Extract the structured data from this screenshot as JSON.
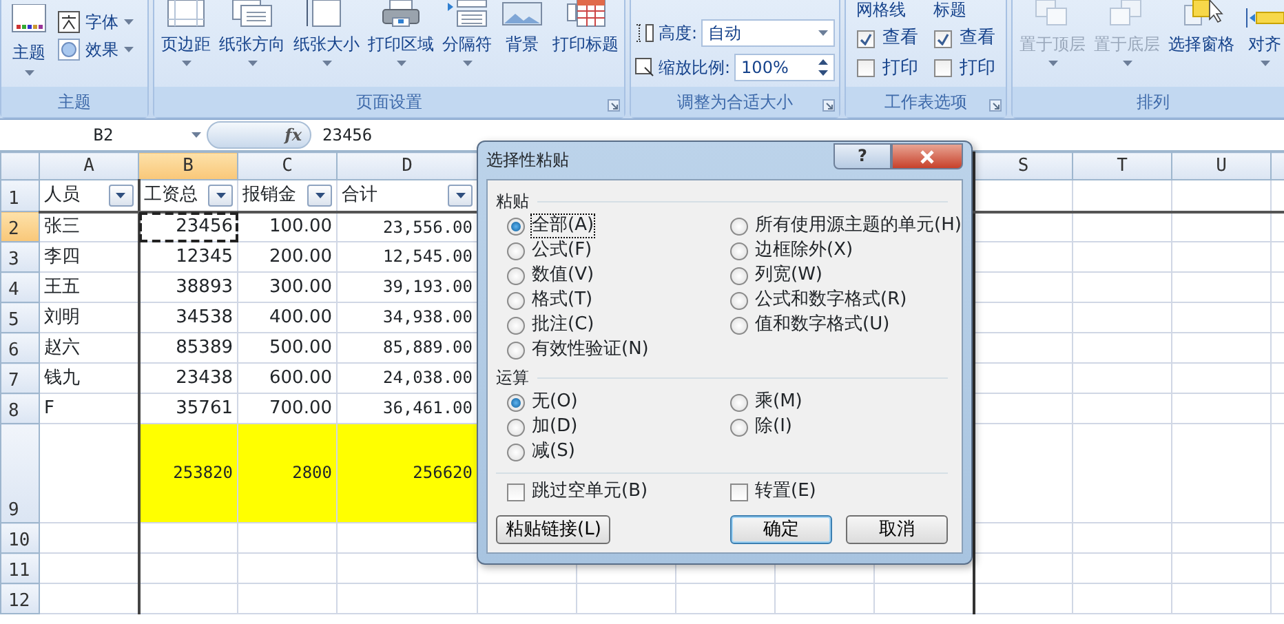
{
  "ribbon": {
    "groups": [
      {
        "kind": "theme",
        "title": "主题",
        "main": {
          "label": "主题",
          "dropdown": true
        },
        "items": [
          {
            "label": "字体",
            "dropdown": true
          },
          {
            "label": "效果",
            "dropdown": true
          }
        ],
        "launcher": false
      },
      {
        "kind": "buttons",
        "title": "页面设置",
        "buttons": [
          {
            "label": "页边距",
            "dropdown": true,
            "disabled": false
          },
          {
            "label": "纸张方向",
            "dropdown": true,
            "disabled": false
          },
          {
            "label": "纸张大小",
            "dropdown": true,
            "disabled": false
          },
          {
            "label": "打印区域",
            "dropdown": true,
            "disabled": false
          },
          {
            "label": "分隔符",
            "dropdown": true,
            "disabled": false
          },
          {
            "label": "背景",
            "dropdown": false,
            "disabled": false
          },
          {
            "label": "打印标题",
            "dropdown": false,
            "disabled": false
          }
        ],
        "launcher": true
      },
      {
        "kind": "fields",
        "title": "调整为合适大小",
        "fields": [
          {
            "kind": "dropdown",
            "label": "高度:",
            "value": "自动"
          },
          {
            "kind": "spin",
            "label": "缩放比例:",
            "value": "100%"
          }
        ],
        "launcher": true
      },
      {
        "kind": "options",
        "title": "工作表选项",
        "columns": [
          {
            "title": "网格线",
            "options": [
              {
                "label": "查看",
                "checked": true
              },
              {
                "label": "打印",
                "checked": false
              }
            ]
          },
          {
            "title": "标题",
            "options": [
              {
                "label": "查看",
                "checked": true
              },
              {
                "label": "打印",
                "checked": false
              }
            ]
          }
        ],
        "launcher": true
      },
      {
        "kind": "buttons",
        "title": "排列",
        "buttons": [
          {
            "label": "置于顶层",
            "dropdown": true,
            "disabled": true
          },
          {
            "label": "置于底层",
            "dropdown": true,
            "disabled": true
          },
          {
            "label": "选择窗格",
            "dropdown": false,
            "disabled": false
          },
          {
            "label": "对齐",
            "dropdown": true,
            "disabled": false
          }
        ],
        "launcher": false
      }
    ]
  },
  "formula_bar": {
    "name_box": "B2",
    "function_label": "fx",
    "value": "23456"
  },
  "sheet": {
    "columns_left": [
      {
        "label": "A",
        "selected": false
      },
      {
        "label": "B",
        "selected": true
      },
      {
        "label": "C",
        "selected": false
      },
      {
        "label": "D",
        "selected": false
      }
    ],
    "columns_right": [
      {
        "label": "S",
        "selected": false
      },
      {
        "label": "T",
        "selected": false
      },
      {
        "label": "U",
        "selected": false
      }
    ],
    "rows": [
      {
        "number": "1",
        "selected": false,
        "kind": "header",
        "cells": [
          {
            "text": "人员",
            "copied": false
          },
          {
            "text": "工资总",
            "copied": false
          },
          {
            "text": "报销金",
            "copied": false
          },
          {
            "text": "合计",
            "copied": false
          }
        ]
      },
      {
        "number": "2",
        "selected": true,
        "kind": "data",
        "cells": [
          {
            "text": "张三",
            "copied": false
          },
          {
            "text": "23456",
            "copied": true
          },
          {
            "text": "100.00",
            "copied": false
          },
          {
            "text": "23,556.00",
            "copied": false
          }
        ]
      },
      {
        "number": "3",
        "selected": false,
        "kind": "data",
        "cells": [
          {
            "text": "李四",
            "copied": false
          },
          {
            "text": "12345",
            "copied": false
          },
          {
            "text": "200.00",
            "copied": false
          },
          {
            "text": "12,545.00",
            "copied": false
          }
        ]
      },
      {
        "number": "4",
        "selected": false,
        "kind": "data",
        "cells": [
          {
            "text": "王五",
            "copied": false
          },
          {
            "text": "38893",
            "copied": false
          },
          {
            "text": "300.00",
            "copied": false
          },
          {
            "text": "39,193.00",
            "copied": false
          }
        ]
      },
      {
        "number": "5",
        "selected": false,
        "kind": "data",
        "cells": [
          {
            "text": "刘明",
            "copied": false
          },
          {
            "text": "34538",
            "copied": false
          },
          {
            "text": "400.00",
            "copied": false
          },
          {
            "text": "34,938.00",
            "copied": false
          }
        ]
      },
      {
        "number": "6",
        "selected": false,
        "kind": "data",
        "cells": [
          {
            "text": "赵六",
            "copied": false
          },
          {
            "text": "85389",
            "copied": false
          },
          {
            "text": "500.00",
            "copied": false
          },
          {
            "text": "85,889.00",
            "copied": false
          }
        ]
      },
      {
        "number": "7",
        "selected": false,
        "kind": "data",
        "cells": [
          {
            "text": "钱九",
            "copied": false
          },
          {
            "text": "23438",
            "copied": false
          },
          {
            "text": "600.00",
            "copied": false
          },
          {
            "text": "24,038.00",
            "copied": false
          }
        ]
      },
      {
        "number": "8",
        "selected": false,
        "kind": "data",
        "cells": [
          {
            "text": "F",
            "copied": false
          },
          {
            "text": "35761",
            "copied": false
          },
          {
            "text": "700.00",
            "copied": false
          },
          {
            "text": "36,461.00",
            "copied": false
          }
        ]
      },
      {
        "number": "9",
        "selected": false,
        "kind": "total",
        "cells": [
          null,
          {
            "text": "253820",
            "copied": false
          },
          {
            "text": "2800",
            "copied": false
          },
          {
            "text": "256620",
            "copied": false
          }
        ]
      },
      {
        "number": "10",
        "selected": false,
        "kind": "empty"
      },
      {
        "number": "11",
        "selected": false,
        "kind": "empty"
      },
      {
        "number": "12",
        "selected": false,
        "kind": "empty"
      }
    ]
  },
  "dialog": {
    "title": "选择性粘贴",
    "help": "?",
    "paste": {
      "title": "粘贴",
      "left": [
        {
          "label": "全部(A)",
          "selected": true,
          "focused": true
        },
        {
          "label": "公式(F)",
          "selected": false,
          "focused": false
        },
        {
          "label": "数值(V)",
          "selected": false,
          "focused": false
        },
        {
          "label": "格式(T)",
          "selected": false,
          "focused": false
        },
        {
          "label": "批注(C)",
          "selected": false,
          "focused": false
        },
        {
          "label": "有效性验证(N)",
          "selected": false,
          "focused": false
        }
      ],
      "right": [
        {
          "label": "所有使用源主题的单元(H)",
          "selected": false,
          "focused": false
        },
        {
          "label": "边框除外(X)",
          "selected": false,
          "focused": false
        },
        {
          "label": "列宽(W)",
          "selected": false,
          "focused": false
        },
        {
          "label": "公式和数字格式(R)",
          "selected": false,
          "focused": false
        },
        {
          "label": "值和数字格式(U)",
          "selected": false,
          "focused": false
        }
      ]
    },
    "operation": {
      "title": "运算",
      "left": [
        {
          "label": "无(O)",
          "selected": true,
          "focused": false
        },
        {
          "label": "加(D)",
          "selected": false,
          "focused": false
        },
        {
          "label": "减(S)",
          "selected": false,
          "focused": false
        }
      ],
      "right": [
        {
          "label": "乘(M)",
          "selected": false,
          "focused": false
        },
        {
          "label": "除(I)",
          "selected": false,
          "focused": false
        }
      ]
    },
    "checkboxes": [
      {
        "label": "跳过空单元(B)",
        "checked": false
      },
      {
        "label": "转置(E)",
        "checked": false
      }
    ],
    "buttons": [
      {
        "label": "粘贴链接(L)",
        "default": false
      },
      {
        "label": "确定",
        "default": true
      },
      {
        "label": "取消",
        "default": false
      }
    ]
  }
}
